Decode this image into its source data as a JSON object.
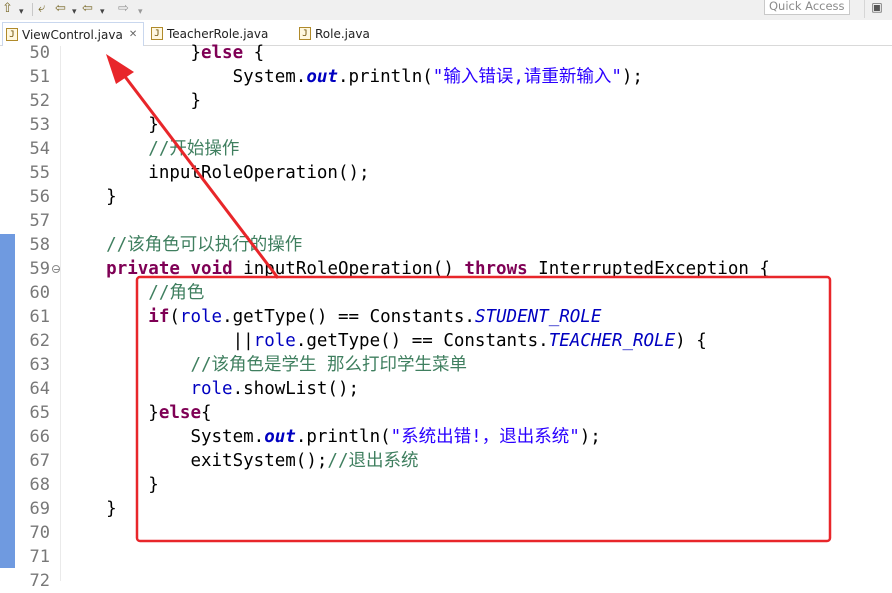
{
  "toolbar": {
    "quick_access_placeholder": "Quick Access"
  },
  "tabs": [
    {
      "label": "ViewControl.java",
      "active": true
    },
    {
      "label": "TeacherRole.java",
      "active": false
    },
    {
      "label": "Role.java",
      "active": false
    }
  ],
  "editor": {
    "lines": [
      {
        "num": "50",
        "indent": "            ",
        "tokens": [
          {
            "t": "}",
            "c": ""
          },
          {
            "t": "else",
            "c": "kw"
          },
          {
            "t": " {",
            "c": ""
          }
        ]
      },
      {
        "num": "51",
        "indent": "                ",
        "tokens": [
          {
            "t": "System.",
            "c": ""
          },
          {
            "t": "out",
            "c": "so"
          },
          {
            "t": ".println(",
            "c": ""
          },
          {
            "t": "\"输入错误,请重新输入\"",
            "c": "st"
          },
          {
            "t": ");",
            "c": ""
          }
        ]
      },
      {
        "num": "52",
        "indent": "            ",
        "tokens": [
          {
            "t": "}",
            "c": ""
          }
        ]
      },
      {
        "num": "53",
        "indent": "        ",
        "tokens": [
          {
            "t": "}",
            "c": ""
          }
        ]
      },
      {
        "num": "54",
        "indent": "        ",
        "tokens": [
          {
            "t": "//开始操作",
            "c": "cm"
          }
        ]
      },
      {
        "num": "55",
        "indent": "        ",
        "tokens": [
          {
            "t": "inputRoleOperation();",
            "c": ""
          }
        ]
      },
      {
        "num": "56",
        "indent": "    ",
        "tokens": [
          {
            "t": "}",
            "c": ""
          }
        ]
      },
      {
        "num": "57",
        "indent": "",
        "tokens": []
      },
      {
        "num": "58",
        "indent": "    ",
        "tokens": [
          {
            "t": "//该角色可以执行的操作",
            "c": "cm"
          }
        ]
      },
      {
        "num": "59",
        "indent": "    ",
        "tokens": [
          {
            "t": "private",
            "c": "kw"
          },
          {
            "t": " ",
            "c": ""
          },
          {
            "t": "void",
            "c": "kw"
          },
          {
            "t": " inputRoleOperation() ",
            "c": ""
          },
          {
            "t": "throws",
            "c": "kw"
          },
          {
            "t": " InterruptedException {",
            "c": ""
          }
        ]
      },
      {
        "num": "60",
        "indent": "        ",
        "tokens": [
          {
            "t": "//角色",
            "c": "cm"
          }
        ]
      },
      {
        "num": "61",
        "indent": "        ",
        "tokens": [
          {
            "t": "if",
            "c": "kw"
          },
          {
            "t": "(",
            "c": ""
          },
          {
            "t": "role",
            "c": "fld"
          },
          {
            "t": ".getType() == Constants.",
            "c": ""
          },
          {
            "t": "STUDENT_ROLE",
            "c": "sf"
          }
        ]
      },
      {
        "num": "62",
        "indent": "                ",
        "tokens": [
          {
            "t": "||",
            "c": ""
          },
          {
            "t": "role",
            "c": "fld"
          },
          {
            "t": ".getType() == Constants.",
            "c": ""
          },
          {
            "t": "TEACHER_ROLE",
            "c": "sf"
          },
          {
            "t": ") {",
            "c": ""
          }
        ]
      },
      {
        "num": "63",
        "indent": "            ",
        "tokens": [
          {
            "t": "//该角色是学生 那么打印学生菜单",
            "c": "cm"
          }
        ]
      },
      {
        "num": "64",
        "indent": "            ",
        "tokens": [
          {
            "t": "role",
            "c": "fld"
          },
          {
            "t": ".showList();",
            "c": ""
          }
        ]
      },
      {
        "num": "65",
        "indent": "        ",
        "tokens": [
          {
            "t": "}",
            "c": ""
          },
          {
            "t": "else",
            "c": "kw"
          },
          {
            "t": "{",
            "c": ""
          }
        ]
      },
      {
        "num": "66",
        "indent": "            ",
        "tokens": [
          {
            "t": "System.",
            "c": ""
          },
          {
            "t": "out",
            "c": "so"
          },
          {
            "t": ".println(",
            "c": ""
          },
          {
            "t": "\"系统出错!，退出系统\"",
            "c": "st"
          },
          {
            "t": ");",
            "c": ""
          }
        ]
      },
      {
        "num": "67",
        "indent": "            ",
        "tokens": [
          {
            "t": "exitSystem();",
            "c": ""
          },
          {
            "t": "//退出系统",
            "c": "cm"
          }
        ]
      },
      {
        "num": "68",
        "indent": "        ",
        "tokens": [
          {
            "t": "}",
            "c": ""
          }
        ]
      },
      {
        "num": "69",
        "indent": "    ",
        "tokens": [
          {
            "t": "}",
            "c": ""
          }
        ]
      },
      {
        "num": "70",
        "indent": "",
        "tokens": []
      },
      {
        "num": "71",
        "indent": "",
        "tokens": []
      },
      {
        "num": "72",
        "indent": "",
        "tokens": []
      }
    ]
  },
  "annotation": {
    "box_color": "#e8262a",
    "arrow_color": "#e8262a"
  }
}
